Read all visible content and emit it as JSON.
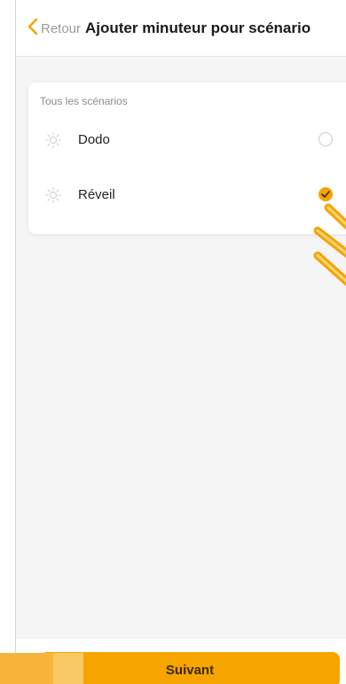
{
  "header": {
    "back_label": "Retour",
    "title": "Ajouter minuteur pour scénario"
  },
  "scenarios": {
    "group_label": "Tous les scénarios",
    "items": [
      {
        "label": "Dodo",
        "icon": "sun-icon",
        "selected": false
      },
      {
        "label": "Réveil",
        "icon": "sun-icon",
        "selected": true
      }
    ]
  },
  "footer": {
    "next_label": "Suivant"
  },
  "colors": {
    "accent": "#f6a400",
    "background": "#f5f5f5"
  }
}
